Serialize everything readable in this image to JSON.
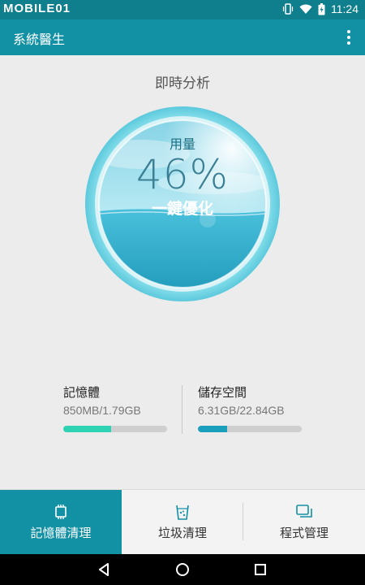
{
  "status_bar": {
    "watermark": "MOBILE01",
    "time": "11:24",
    "icons": [
      "vibrate-icon",
      "wifi-icon",
      "battery-icon"
    ]
  },
  "app_bar": {
    "title": "系統醫生",
    "menu_icon": "overflow-menu-icon"
  },
  "main": {
    "section_title": "即時分析",
    "gauge": {
      "label": "用量",
      "percent_text": "46%",
      "percent_value": 46,
      "button_label": "一鍵優化"
    },
    "stats": [
      {
        "title": "記憶體",
        "value": "850MB/1.79GB",
        "fraction": 0.46,
        "color": "#2ed3b6"
      },
      {
        "title": "儲存空間",
        "value": "6.31GB/22.84GB",
        "fraction": 0.28,
        "color": "#1aa0bd"
      }
    ]
  },
  "bottom_tabs": [
    {
      "label": "記憶體清理",
      "icon": "memory-chip-icon",
      "active": true
    },
    {
      "label": "垃圾清理",
      "icon": "trash-cup-icon",
      "active": false
    },
    {
      "label": "程式管理",
      "icon": "app-windows-icon",
      "active": false
    }
  ],
  "nav_bar": {
    "buttons": [
      "back-icon",
      "home-icon",
      "recents-icon"
    ]
  },
  "colors": {
    "status_bar": "#0f7f8e",
    "app_bar": "#1290a4",
    "accent": "#1290a4",
    "background": "#ececec"
  }
}
